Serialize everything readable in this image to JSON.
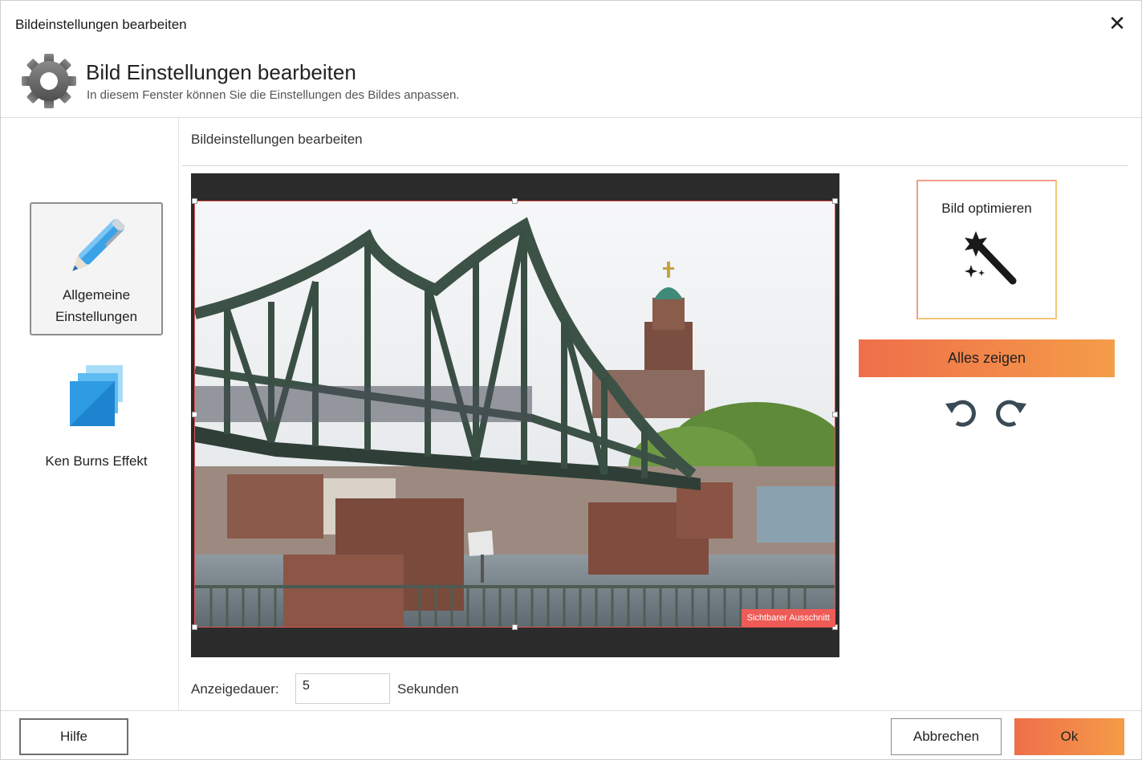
{
  "window": {
    "title": "Bildeinstellungen bearbeiten",
    "close_glyph": "✕"
  },
  "header": {
    "icon": "gear-icon",
    "title": "Bild Einstellungen bearbeiten",
    "subtitle": "In diesem Fenster können Sie die Einstellungen des Bildes anpassen."
  },
  "sidebar": {
    "items": [
      {
        "label": "Allgemeine Einstellungen",
        "icon": "pen-icon",
        "active": true
      },
      {
        "label": "Ken Burns Effekt",
        "icon": "layers-icon",
        "active": false
      }
    ]
  },
  "main": {
    "section_title": "Bildeinstellungen bearbeiten",
    "crop_label": "Sichtbarer Ausschnitt",
    "optimize_label": "Bild optimieren",
    "optimize_icon": "magic-wand-icon",
    "show_all_label": "Alles zeigen",
    "rotate_icons": [
      "rotate-left-icon",
      "rotate-right-icon"
    ],
    "duration": {
      "label": "Anzeigedauer:",
      "value": "5",
      "unit": "Sekunden"
    }
  },
  "footer": {
    "help_label": "Hilfe",
    "cancel_label": "Abbrechen",
    "ok_label": "Ok"
  },
  "colors": {
    "accent_start": "#ef6f4a",
    "accent_end": "#f49c48",
    "crop_border": "#e0524f"
  }
}
